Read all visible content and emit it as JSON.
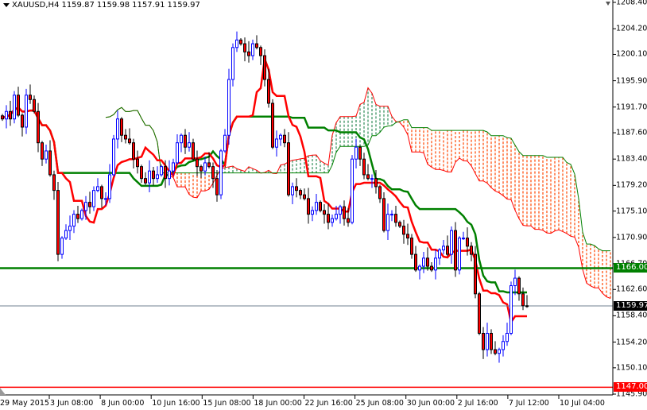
{
  "header": {
    "symbol": "XAUUSD,H4",
    "open": "1159.87",
    "high": "1159.98",
    "low": "1157.91",
    "close": "1159.97"
  },
  "colors": {
    "bull": "#0000ff",
    "bear_body": "#ff0000",
    "bear_wick": "#000000",
    "tenkan": "#ff0000",
    "kijun": "#008000",
    "span_a": "#ff0000",
    "span_b": "#008000",
    "cloud_bear": "#ff4500",
    "cloud_bull": "#2e8b57",
    "support": "#008000",
    "low_line": "#ff0000",
    "bid": "#708090"
  },
  "price_axis": [
    "1208.40",
    "1204.20",
    "1200.10",
    "1195.90",
    "1191.70",
    "1187.60",
    "1183.40",
    "1179.20",
    "1175.10",
    "1170.90",
    "1166.70",
    "1162.60",
    "1158.40",
    "1154.20",
    "1150.10",
    "1145.90"
  ],
  "levels": [
    {
      "label": "1166.00",
      "value": 1166.0,
      "type": "support"
    },
    {
      "label": "1159.97",
      "value": 1159.97,
      "type": "bid"
    },
    {
      "label": "1147.00",
      "value": 1147.0,
      "type": "low_line"
    }
  ],
  "time_axis": [
    "29 May 2015",
    "3 Jun 08:00",
    "8 Jun 00:00",
    "10 Jun 16:00",
    "15 Jun 08:00",
    "18 Jun 00:00",
    "22 Jun 16:00",
    "25 Jun 08:00",
    "30 Jun 00:00",
    "2 Jul 16:00",
    "7 Jul 12:00",
    "10 Jul 04:00"
  ],
  "chart_data": {
    "type": "candlestick",
    "title": "XAUUSD,H4",
    "indicator": "Ichimoku",
    "ichimoku": {
      "tenkan": 9,
      "kijun": 26,
      "senkou_b": 52
    },
    "ylim": [
      1145.9,
      1208.4
    ],
    "closes": [
      1189.8,
      1191.0,
      1189.8,
      1193.6,
      1190.4,
      1188.5,
      1193.6,
      1192.9,
      1191.0,
      1186.0,
      1183.4,
      1184.7,
      1180.9,
      1178.4,
      1168.2,
      1170.8,
      1172.0,
      1172.7,
      1174.6,
      1173.9,
      1175.2,
      1176.5,
      1175.8,
      1178.4,
      1179.0,
      1177.1,
      1177.1,
      1180.9,
      1186.6,
      1189.8,
      1187.2,
      1186.6,
      1186.0,
      1183.4,
      1182.2,
      1180.3,
      1179.6,
      1181.5,
      1180.3,
      1180.9,
      1182.2,
      1180.3,
      1181.5,
      1182.8,
      1186.0,
      1187.2,
      1185.3,
      1186.0,
      1183.4,
      1182.2,
      1181.5,
      1182.8,
      1182.2,
      1180.3,
      1177.7,
      1184.7,
      1187.2,
      1196.1,
      1201.2,
      1202.4,
      1201.8,
      1200.5,
      1199.9,
      1201.8,
      1201.2,
      1199.9,
      1196.1,
      1192.3,
      1185.3,
      1186.6,
      1187.2,
      1186.0,
      1177.7,
      1179.0,
      1178.4,
      1177.7,
      1177.1,
      1174.6,
      1175.2,
      1176.5,
      1175.2,
      1174.6,
      1173.3,
      1173.9,
      1174.6,
      1175.8,
      1173.9,
      1173.3,
      1183.4,
      1185.3,
      1183.4,
      1180.9,
      1180.3,
      1180.3,
      1179.0,
      1177.1,
      1172.0,
      1174.6,
      1174.6,
      1173.3,
      1172.7,
      1171.4,
      1170.8,
      1168.2,
      1165.7,
      1166.3,
      1167.6,
      1166.3,
      1165.7,
      1167.6,
      1168.9,
      1169.5,
      1168.2,
      1172.0,
      1165.7,
      1170.8,
      1170.8,
      1169.5,
      1168.2,
      1161.9,
      1155.6,
      1153.0,
      1155.6,
      1153.0,
      1152.4,
      1153.0,
      1154.3,
      1155.6,
      1163.2,
      1164.4,
      1161.9,
      1160.0,
      1159.97
    ]
  }
}
